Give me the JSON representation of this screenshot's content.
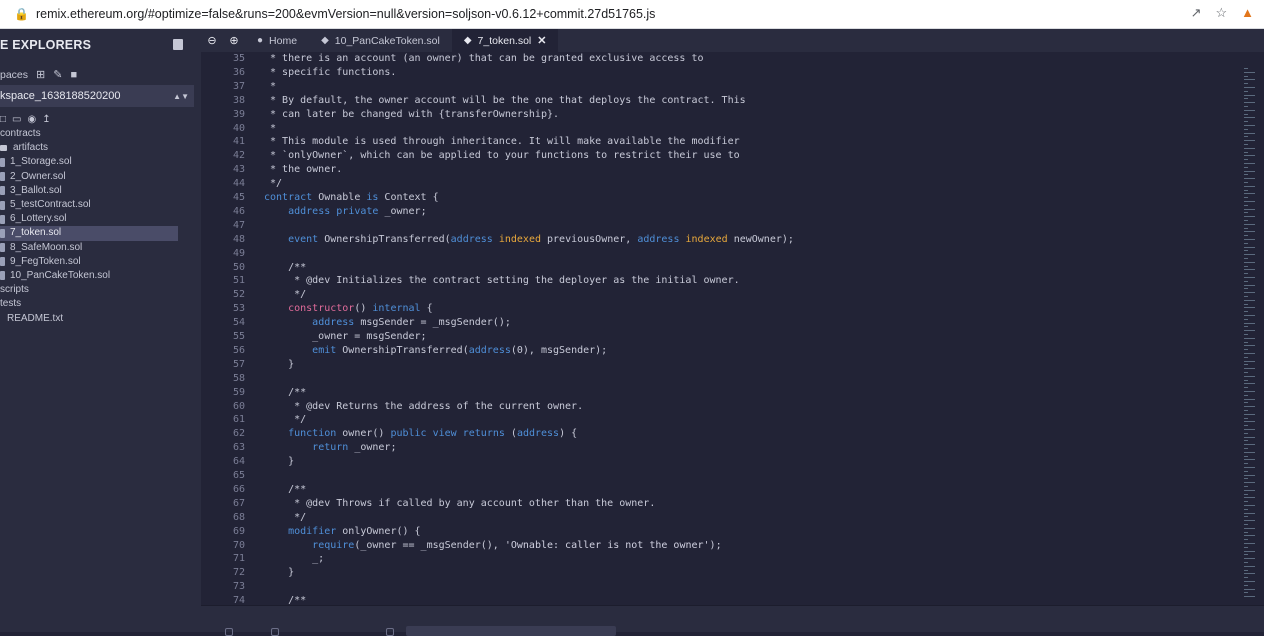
{
  "browser": {
    "url": "remix.ethereum.org/#optimize=false&runs=200&evmVersion=null&version=soljson-v0.6.12+commit.27d51765.js"
  },
  "sidebar": {
    "title": "E EXPLORERS",
    "workspaces_label": "paces",
    "workspace_name": "kspace_1638188520200",
    "tree": [
      {
        "label": "contracts",
        "kind": "folder"
      },
      {
        "label": "artifacts",
        "kind": "folder-open"
      },
      {
        "label": "1_Storage.sol",
        "kind": "file"
      },
      {
        "label": "2_Owner.sol",
        "kind": "file"
      },
      {
        "label": "3_Ballot.sol",
        "kind": "file"
      },
      {
        "label": "5_testContract.sol",
        "kind": "file"
      },
      {
        "label": "6_Lottery.sol",
        "kind": "file"
      },
      {
        "label": "7_token.sol",
        "kind": "file",
        "selected": true
      },
      {
        "label": "8_SafeMoon.sol",
        "kind": "file"
      },
      {
        "label": "9_FegToken.sol",
        "kind": "file"
      },
      {
        "label": "10_PanCakeToken.sol",
        "kind": "file"
      },
      {
        "label": "scripts",
        "kind": "folder"
      },
      {
        "label": "tests",
        "kind": "folder"
      },
      {
        "label": "README.txt",
        "kind": "file-plain"
      }
    ]
  },
  "tabs": [
    {
      "label": "Home",
      "icon": "remix-icon"
    },
    {
      "label": "10_PanCakeToken.sol",
      "icon": "solidity-icon"
    },
    {
      "label": "7_token.sol",
      "icon": "solidity-icon",
      "active": true
    }
  ],
  "editor": {
    "lines": [
      {
        "n": "35",
        "t": " * there is an account (an owner) that can be granted exclusive access to",
        "s": "c"
      },
      {
        "n": "36",
        "t": " * specific functions.",
        "s": "c"
      },
      {
        "n": "37",
        "t": " *",
        "s": "c"
      },
      {
        "n": "38",
        "t": " * By default, the owner account will be the one that deploys the contract. This",
        "s": "c"
      },
      {
        "n": "39",
        "t": " * can later be changed with {transferOwnership}.",
        "s": "c"
      },
      {
        "n": "40",
        "t": " *",
        "s": "c"
      },
      {
        "n": "41",
        "t": " * This module is used through inheritance. It will make available the modifier",
        "s": "c"
      },
      {
        "n": "42",
        "t": " * `onlyOwner`, which can be applied to your functions to restrict their use to",
        "s": "c"
      },
      {
        "n": "43",
        "t": " * the owner.",
        "s": "c"
      },
      {
        "n": "44",
        "t": " */",
        "s": "c"
      },
      {
        "n": "45",
        "t": "contract Ownable is Context {",
        "s": "code"
      },
      {
        "n": "46",
        "t": "    address private _owner;",
        "s": "code"
      },
      {
        "n": "47",
        "t": "",
        "s": "code"
      },
      {
        "n": "48",
        "t": "    event OwnershipTransferred(address indexed previousOwner, address indexed newOwner);",
        "s": "code"
      },
      {
        "n": "49",
        "t": "",
        "s": "code"
      },
      {
        "n": "50",
        "t": "    /**",
        "s": "c"
      },
      {
        "n": "51",
        "t": "     * @dev Initializes the contract setting the deployer as the initial owner.",
        "s": "c"
      },
      {
        "n": "52",
        "t": "     */",
        "s": "c"
      },
      {
        "n": "53",
        "t": "    constructor() internal {",
        "s": "code"
      },
      {
        "n": "54",
        "t": "        address msgSender = _msgSender();",
        "s": "code"
      },
      {
        "n": "55",
        "t": "        _owner = msgSender;",
        "s": "code"
      },
      {
        "n": "56",
        "t": "        emit OwnershipTransferred(address(0), msgSender);",
        "s": "code"
      },
      {
        "n": "57",
        "t": "    }",
        "s": "code"
      },
      {
        "n": "58",
        "t": "",
        "s": "code"
      },
      {
        "n": "59",
        "t": "    /**",
        "s": "c"
      },
      {
        "n": "60",
        "t": "     * @dev Returns the address of the current owner.",
        "s": "c"
      },
      {
        "n": "61",
        "t": "     */",
        "s": "c"
      },
      {
        "n": "62",
        "t": "    function owner() public view returns (address) {",
        "s": "code"
      },
      {
        "n": "63",
        "t": "        return _owner;",
        "s": "code"
      },
      {
        "n": "64",
        "t": "    }",
        "s": "code"
      },
      {
        "n": "65",
        "t": "",
        "s": "code"
      },
      {
        "n": "66",
        "t": "    /**",
        "s": "c"
      },
      {
        "n": "67",
        "t": "     * @dev Throws if called by any account other than the owner.",
        "s": "c"
      },
      {
        "n": "68",
        "t": "     */",
        "s": "c"
      },
      {
        "n": "69",
        "t": "    modifier onlyOwner() {",
        "s": "code"
      },
      {
        "n": "70",
        "t": "        require(_owner == _msgSender(), 'Ownable: caller is not the owner');",
        "s": "code"
      },
      {
        "n": "71",
        "t": "        _;",
        "s": "code"
      },
      {
        "n": "72",
        "t": "    }",
        "s": "code"
      },
      {
        "n": "73",
        "t": "",
        "s": "code"
      },
      {
        "n": "74",
        "t": "    /**",
        "s": "c"
      }
    ]
  }
}
